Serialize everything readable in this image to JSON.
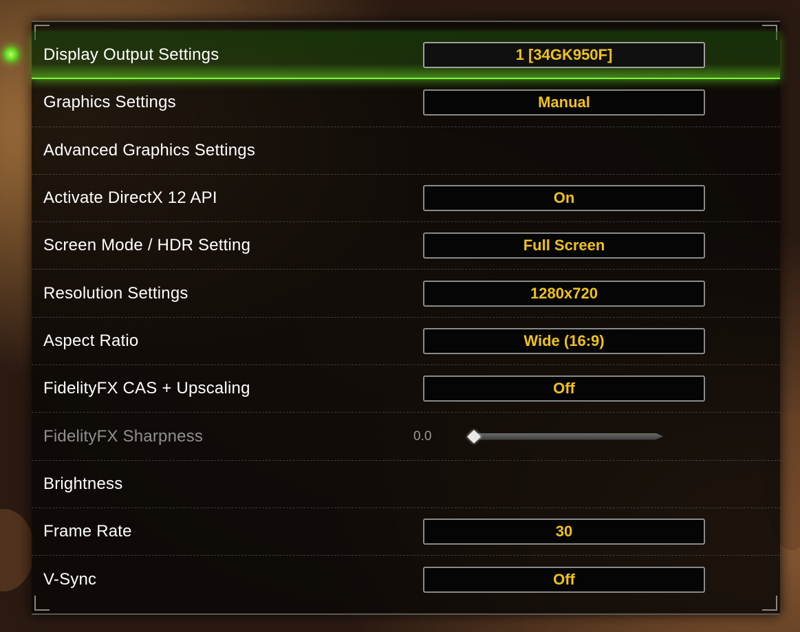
{
  "settings": {
    "rows": [
      {
        "label": "Display Output Settings",
        "value": "1 [34GK950F]"
      },
      {
        "label": "Graphics Settings",
        "value": "Manual"
      },
      {
        "label": "Advanced Graphics Settings"
      },
      {
        "label": "Activate DirectX 12 API",
        "value": "On"
      },
      {
        "label": "Screen Mode / HDR Setting",
        "value": "Full Screen"
      },
      {
        "label": "Resolution Settings",
        "value": "1280x720"
      },
      {
        "label": "Aspect Ratio",
        "value": "Wide (16:9)"
      },
      {
        "label": "FidelityFX CAS + Upscaling",
        "value": "Off"
      },
      {
        "label": "FidelityFX Sharpness",
        "slider_value": "0.0",
        "slider_level": 0.0
      },
      {
        "label": "Brightness"
      },
      {
        "label": "Frame Rate",
        "value": "30"
      },
      {
        "label": "V-Sync",
        "value": "Off"
      }
    ],
    "selected_index": 0
  },
  "colors": {
    "value_text": "#f0c21a",
    "selection_glow": "#7cff3a",
    "label_text": "#ffffff",
    "disabled_text": "#8f8f8f"
  }
}
